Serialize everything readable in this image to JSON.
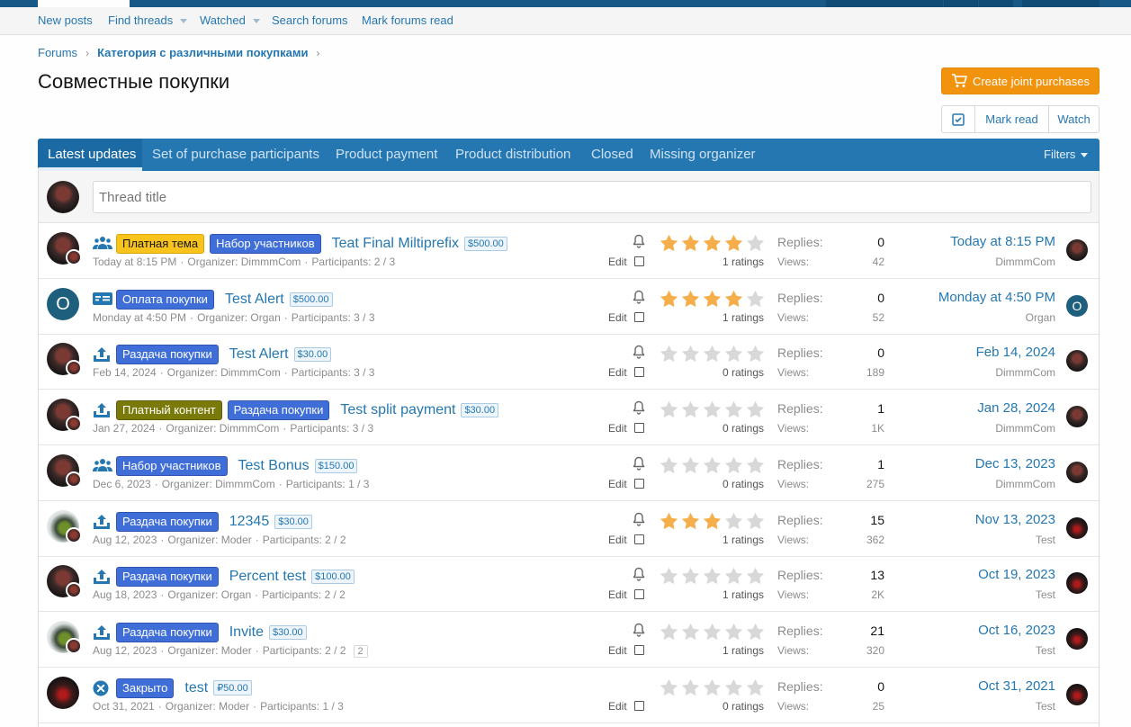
{
  "colors": {
    "accent": "#2577b1",
    "header": "#185886",
    "create_button": "#f2930d",
    "star_filled": "#f5ae4a",
    "star_empty": "#d8d8d8"
  },
  "subnav": {
    "new_posts": "New posts",
    "find_threads": "Find threads",
    "watched": "Watched",
    "search_forums": "Search forums",
    "mark_forums_read": "Mark forums read"
  },
  "breadcrumb": {
    "forums": "Forums",
    "category": "Категория с различными покупками"
  },
  "page_title": "Совместные покупки",
  "buttons": {
    "create": "Create joint purchases",
    "mark_read": "Mark read",
    "watch": "Watch"
  },
  "tabs": [
    "Latest updates",
    "Set of purchase participants",
    "Product payment",
    "Product distribution",
    "Closed",
    "Missing organizer"
  ],
  "filters_label": "Filters",
  "thread_input_placeholder": "Thread title",
  "labels": {
    "edit": "Edit",
    "replies": "Replies:",
    "views": "Views:"
  },
  "threads": [
    {
      "icon": "group-icon",
      "prefixes": [
        {
          "text": "Платная тема",
          "color": "yellow"
        },
        {
          "text": "Набор участников",
          "color": "blue"
        }
      ],
      "title": "Teat Final Miltiprefix",
      "price": "$500.00",
      "date": "Today at 8:15 PM",
      "organizer": "Organizer: DimmmCom",
      "participants": "Participants: 2 / 3",
      "rating": 4,
      "ratings": "1 ratings",
      "replies": "0",
      "views": "42",
      "last_date": "Today at 8:15 PM",
      "last_user": "DimmmCom",
      "avatar": "dark",
      "last_avatar": "dark",
      "bell": true
    },
    {
      "icon": "payment-icon",
      "prefixes": [
        {
          "text": "Оплата покупки",
          "color": "blue"
        }
      ],
      "title": "Test Alert",
      "price": "$500.00",
      "date": "Monday at 4:50 PM",
      "organizer": "Organizer: Organ",
      "participants": "Participants: 3 / 3",
      "rating": 4,
      "ratings": "1 ratings",
      "replies": "0",
      "views": "52",
      "last_date": "Monday at 4:50 PM",
      "last_user": "Organ",
      "avatar": "letter",
      "avatar_letter": "O",
      "last_avatar": "letter",
      "bell": true
    },
    {
      "icon": "upload-icon",
      "prefixes": [
        {
          "text": "Раздача покупки",
          "color": "blue"
        }
      ],
      "title": "Test Alert",
      "price": "$30.00",
      "date": "Feb 14, 2024",
      "organizer": "Organizer: DimmmCom",
      "participants": "Participants: 3 / 3",
      "rating": 0,
      "ratings": "0 ratings",
      "replies": "0",
      "views": "189",
      "last_date": "Feb 14, 2024",
      "last_user": "DimmmCom",
      "avatar": "dark",
      "last_avatar": "dark",
      "bell": true
    },
    {
      "icon": "upload-icon",
      "prefixes": [
        {
          "text": "Платный контент",
          "color": "olive"
        },
        {
          "text": "Раздача покупки",
          "color": "blue"
        }
      ],
      "title": "Test split payment",
      "price": "$30.00",
      "date": "Jan 27, 2024",
      "organizer": "Organizer: DimmmCom",
      "participants": "Participants: 3 / 3",
      "rating": 0,
      "ratings": "0 ratings",
      "replies": "1",
      "views": "1K",
      "last_date": "Jan 28, 2024",
      "last_user": "DimmmCom",
      "avatar": "dark",
      "last_avatar": "dark",
      "bell": true
    },
    {
      "icon": "group-icon",
      "prefixes": [
        {
          "text": "Набор участников",
          "color": "blue"
        }
      ],
      "title": "Test Bonus",
      "price": "$150.00",
      "date": "Dec 6, 2023",
      "organizer": "Organizer: DimmmCom",
      "participants": "Participants: 1 / 3",
      "rating": 0,
      "ratings": "0 ratings",
      "replies": "1",
      "views": "275",
      "last_date": "Dec 13, 2023",
      "last_user": "DimmmCom",
      "avatar": "dark",
      "last_avatar": "dark",
      "bell": true
    },
    {
      "icon": "upload-icon",
      "prefixes": [
        {
          "text": "Раздача покупки",
          "color": "blue"
        }
      ],
      "title": "12345",
      "price": "$30.00",
      "date": "Aug 12, 2023",
      "organizer": "Organizer: Moder",
      "participants": "Participants: 2 / 2",
      "rating": 3,
      "ratings": "1 ratings",
      "replies": "15",
      "views": "362",
      "last_date": "Nov 13, 2023",
      "last_user": "Test",
      "avatar": "car",
      "last_avatar": "red",
      "bell": true
    },
    {
      "icon": "upload-icon",
      "prefixes": [
        {
          "text": "Раздача покупки",
          "color": "blue"
        }
      ],
      "title": "Percent test",
      "price": "$100.00",
      "date": "Aug 18, 2023",
      "organizer": "Organizer: Organ",
      "participants": "Participants: 2 / 2",
      "rating": 0,
      "ratings": "1 ratings",
      "replies": "13",
      "views": "2K",
      "last_date": "Oct 19, 2023",
      "last_user": "Test",
      "avatar": "dark",
      "last_avatar": "red",
      "bell": true
    },
    {
      "icon": "upload-icon",
      "prefixes": [
        {
          "text": "Раздача покупки",
          "color": "blue"
        }
      ],
      "title": "Invite",
      "price": "$30.00",
      "date": "Aug 12, 2023",
      "organizer": "Organizer: Moder",
      "participants": "Participants: 2 / 2",
      "extra": "2",
      "rating": 0,
      "ratings": "1 ratings",
      "replies": "21",
      "views": "320",
      "last_date": "Oct 16, 2023",
      "last_user": "Test",
      "avatar": "car",
      "last_avatar": "red",
      "bell": true
    },
    {
      "icon": "close-circle-icon",
      "prefixes": [
        {
          "text": "Закрыто",
          "color": "blue"
        }
      ],
      "title": "test",
      "price": "₽50.00",
      "date": "Oct 31, 2021",
      "organizer": "Organizer: Moder",
      "participants": "Participants: 1 / 3",
      "rating": 0,
      "ratings": "0 ratings",
      "replies": "0",
      "views": "25",
      "last_date": "Oct 31, 2021",
      "last_user": "Test",
      "avatar": "red",
      "last_avatar": "red",
      "bell": false
    }
  ]
}
